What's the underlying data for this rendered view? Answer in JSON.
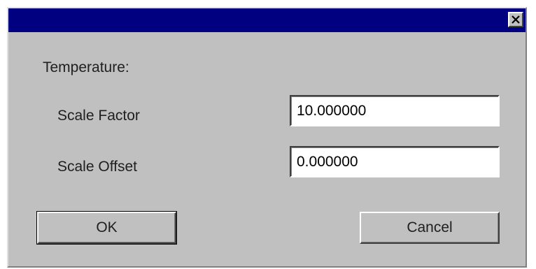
{
  "window": {
    "title": "",
    "close_icon": "close-icon"
  },
  "section_label": "Temperature:",
  "fields": {
    "scale_factor": {
      "label": "Scale Factor",
      "value": "10.000000"
    },
    "scale_offset": {
      "label": "Scale Offset",
      "value": "0.000000"
    }
  },
  "buttons": {
    "ok_label": "OK",
    "cancel_label": "Cancel"
  },
  "colors": {
    "titlebar": "#000080",
    "dialog_face": "#c0c0c0"
  }
}
